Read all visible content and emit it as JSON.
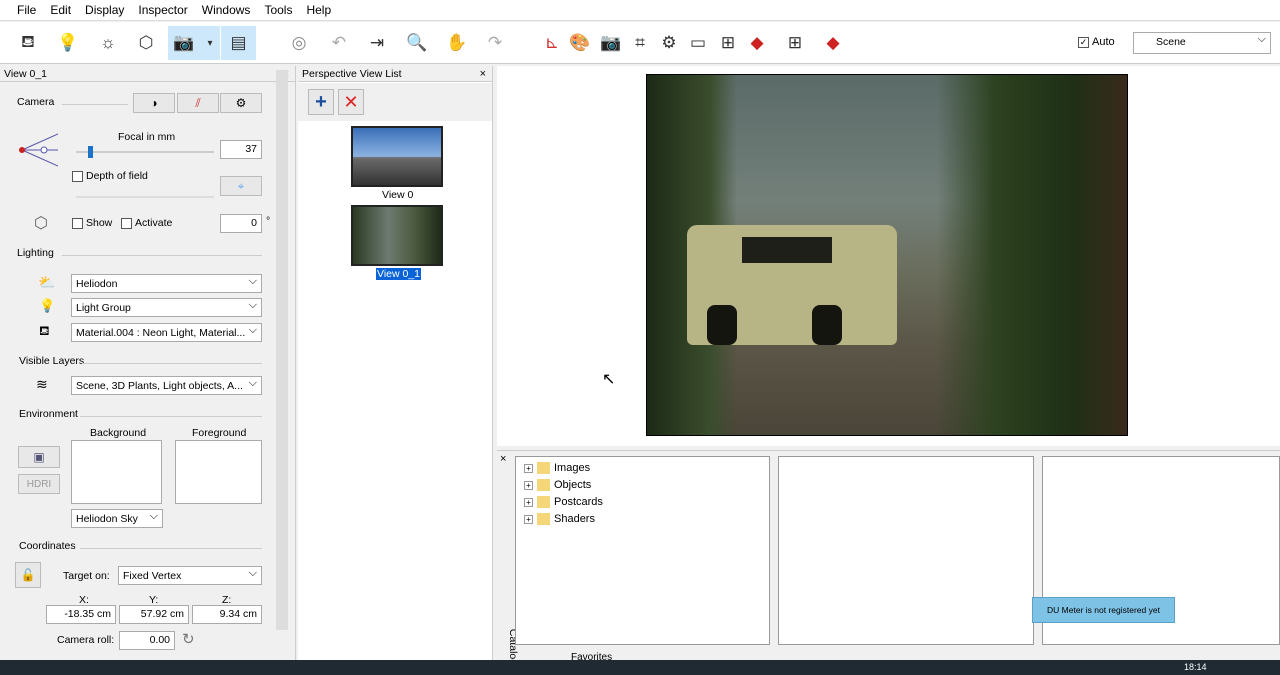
{
  "menu": [
    "File",
    "Edit",
    "Display",
    "Inspector",
    "Windows",
    "Tools",
    "Help"
  ],
  "toolbar": {
    "auto_label": "Auto",
    "auto_checked": true,
    "scene_select": "Scene"
  },
  "left_panel": {
    "title": "View 0_1",
    "camera": {
      "section": "Camera",
      "focal_label": "Focal in mm",
      "focal_value": "37",
      "focal_fraction": 0.1,
      "dof_label": "Depth of field",
      "show_label": "Show",
      "activate_label": "Activate",
      "angle_value": "0",
      "angle_unit": "°"
    },
    "lighting": {
      "section": "Lighting",
      "heliodon": "Heliodon",
      "light_group": "Light Group",
      "material": "Material.004 : Neon Light, Material..."
    },
    "visible_layers": {
      "section": "Visible Layers",
      "value": "Scene, 3D Plants, Light objects, A..."
    },
    "environment": {
      "section": "Environment",
      "background_label": "Background",
      "foreground_label": "Foreground",
      "hdri_label": "HDRI",
      "sky_select": "Heliodon Sky"
    },
    "coordinates": {
      "section": "Coordinates",
      "target_label": "Target on:",
      "target_value": "Fixed Vertex",
      "x_label": "X:",
      "y_label": "Y:",
      "z_label": "Z:",
      "x": "-18.35 cm",
      "y": "57.92 cm",
      "z": "9.34 cm",
      "roll_label": "Camera roll:",
      "roll_value": "0.00"
    }
  },
  "perspective_list": {
    "title": "Perspective View List",
    "views": [
      {
        "label": "View 0"
      },
      {
        "label": "View 0_1",
        "selected": true
      }
    ]
  },
  "catalog": {
    "tab_label": "Catalog",
    "tree": [
      "Images",
      "Objects",
      "Postcards",
      "Shaders"
    ],
    "favorites_label": "Favorites"
  },
  "tooltip": "DU Meter is not registered yet",
  "taskbar": {
    "time": "18:14"
  }
}
